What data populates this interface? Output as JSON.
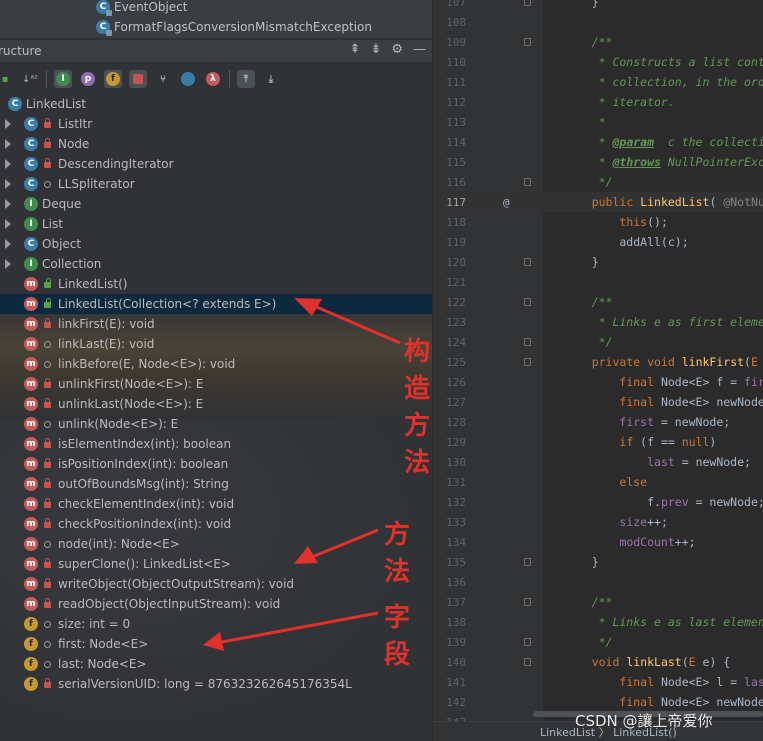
{
  "top_items": [
    {
      "label": "EventObject"
    },
    {
      "label": "FormatFlagsConversionMismatchException"
    }
  ],
  "panel": {
    "title": "ructure"
  },
  "toolbar": {
    "sort_label": "↓a",
    "sort_alpha": "z"
  },
  "tree": [
    {
      "label": "LinkedList",
      "icon": "c",
      "indent": 0,
      "arrow": false,
      "vis": ""
    },
    {
      "label": "ListItr",
      "icon": "c",
      "indent": 1,
      "arrow": true,
      "vis": "lock"
    },
    {
      "label": "Node",
      "icon": "c",
      "indent": 1,
      "arrow": true,
      "vis": "lock"
    },
    {
      "label": "DescendingIterator",
      "icon": "c",
      "indent": 1,
      "arrow": true,
      "vis": "lock"
    },
    {
      "label": "LLSpliterator",
      "icon": "c",
      "indent": 1,
      "arrow": true,
      "vis": "pkg"
    },
    {
      "label": "Deque",
      "icon": "i",
      "indent": 1,
      "arrow": true,
      "vis": "none"
    },
    {
      "label": "List",
      "icon": "i",
      "indent": 1,
      "arrow": true,
      "vis": "none"
    },
    {
      "label": "Object",
      "icon": "c",
      "indent": 1,
      "arrow": true,
      "vis": "none"
    },
    {
      "label": "Collection",
      "icon": "i",
      "indent": 1,
      "arrow": true,
      "vis": "none"
    },
    {
      "label": "LinkedList()",
      "icon": "m",
      "indent": 1,
      "arrow": false,
      "vis": "unlock"
    },
    {
      "label": "LinkedList(Collection<? extends E>)",
      "icon": "m",
      "indent": 1,
      "arrow": false,
      "vis": "unlock",
      "selected": true
    },
    {
      "label": "linkFirst(E): void",
      "icon": "m",
      "indent": 1,
      "arrow": false,
      "vis": "lock"
    },
    {
      "label": "linkLast(E): void",
      "icon": "m",
      "indent": 1,
      "arrow": false,
      "vis": "pkg"
    },
    {
      "label": "linkBefore(E, Node<E>): void",
      "icon": "m",
      "indent": 1,
      "arrow": false,
      "vis": "pkg"
    },
    {
      "label": "unlinkFirst(Node<E>): E",
      "icon": "m",
      "indent": 1,
      "arrow": false,
      "vis": "lock"
    },
    {
      "label": "unlinkLast(Node<E>): E",
      "icon": "m",
      "indent": 1,
      "arrow": false,
      "vis": "lock"
    },
    {
      "label": "unlink(Node<E>): E",
      "icon": "m",
      "indent": 1,
      "arrow": false,
      "vis": "pkg"
    },
    {
      "label": "isElementIndex(int): boolean",
      "icon": "m",
      "indent": 1,
      "arrow": false,
      "vis": "lock"
    },
    {
      "label": "isPositionIndex(int): boolean",
      "icon": "m",
      "indent": 1,
      "arrow": false,
      "vis": "lock"
    },
    {
      "label": "outOfBoundsMsg(int): String",
      "icon": "m",
      "indent": 1,
      "arrow": false,
      "vis": "lock"
    },
    {
      "label": "checkElementIndex(int): void",
      "icon": "m",
      "indent": 1,
      "arrow": false,
      "vis": "lock"
    },
    {
      "label": "checkPositionIndex(int): void",
      "icon": "m",
      "indent": 1,
      "arrow": false,
      "vis": "lock"
    },
    {
      "label": "node(int): Node<E>",
      "icon": "m",
      "indent": 1,
      "arrow": false,
      "vis": "pkg"
    },
    {
      "label": "superClone(): LinkedList<E>",
      "icon": "m",
      "indent": 1,
      "arrow": false,
      "vis": "lock"
    },
    {
      "label": "writeObject(ObjectOutputStream): void",
      "icon": "m",
      "indent": 1,
      "arrow": false,
      "vis": "lock"
    },
    {
      "label": "readObject(ObjectInputStream): void",
      "icon": "m",
      "indent": 1,
      "arrow": false,
      "vis": "lock"
    },
    {
      "label": "size: int = 0",
      "icon": "f",
      "indent": 1,
      "arrow": false,
      "vis": "pkg"
    },
    {
      "label": "first: Node<E>",
      "icon": "f",
      "indent": 1,
      "arrow": false,
      "vis": "pkg"
    },
    {
      "label": "last: Node<E>",
      "icon": "f",
      "indent": 1,
      "arrow": false,
      "vis": "pkg"
    },
    {
      "label": "serialVersionUID: long = 876323262645176354L",
      "icon": "f",
      "indent": 1,
      "arrow": false,
      "vis": "lock"
    }
  ],
  "annotations": {
    "constructor": "构造方法",
    "method": "方法",
    "field": "字段"
  },
  "editor": {
    "lines": [
      {
        "n": "107",
        "html": "    }"
      },
      {
        "n": "108",
        "html": ""
      },
      {
        "n": "109",
        "html": "    <span class='cm'>/**</span>"
      },
      {
        "n": "110",
        "html": "<span class='cm'>     * Constructs a list containi</span>"
      },
      {
        "n": "111",
        "html": "<span class='cm'>     * collection, in the order t</span>"
      },
      {
        "n": "112",
        "html": "<span class='cm'>     * iterator.</span>"
      },
      {
        "n": "113",
        "html": "<span class='cm'>     *</span>"
      },
      {
        "n": "114",
        "html": "<span class='cm'>     * </span><span class='tag'>@param</span><span class='cm'>  c the collection w</span>"
      },
      {
        "n": "115",
        "html": "<span class='cm'>     * </span><span class='tag'>@throws</span><span class='cm'> NullPointerExcepti</span>"
      },
      {
        "n": "116",
        "html": "<span class='cm'>     */</span>"
      },
      {
        "n": "117",
        "html": "    <span class='kw'>public</span> <span class='fn'>LinkedList</span>( <span class='gr'>@NotNull</span>()",
        "cur": true,
        "at": "@"
      },
      {
        "n": "118",
        "html": "        <span class='kw'>this</span>();"
      },
      {
        "n": "119",
        "html": "        addAll(c);"
      },
      {
        "n": "120",
        "html": "    }"
      },
      {
        "n": "121",
        "html": ""
      },
      {
        "n": "122",
        "html": "    <span class='cm'>/**</span>"
      },
      {
        "n": "123",
        "html": "<span class='cm'>     * Links e as first element.</span>"
      },
      {
        "n": "124",
        "html": "<span class='cm'>     */</span>"
      },
      {
        "n": "125",
        "html": "    <span class='kw'>private void</span> <span class='fn'>linkFirst</span>(<span class='kw'>E</span> e) {"
      },
      {
        "n": "126",
        "html": "        <span class='kw'>final</span> Node&lt;E&gt; f = <span class='fld'>first</span>;"
      },
      {
        "n": "127",
        "html": "        <span class='kw'>final</span> Node&lt;E&gt; newNode = <span class='kw'>n</span>"
      },
      {
        "n": "128",
        "html": "        <span class='fld'>first</span> = newNode;"
      },
      {
        "n": "129",
        "html": "        <span class='kw'>if</span> (f == <span class='kw'>null</span>)"
      },
      {
        "n": "130",
        "html": "            <span class='fld'>last</span> = newNode;"
      },
      {
        "n": "131",
        "html": "        <span class='kw'>else</span>"
      },
      {
        "n": "132",
        "html": "            f.<span class='fld'>prev</span> = newNode;"
      },
      {
        "n": "133",
        "html": "        <span class='fld'>size</span>++;"
      },
      {
        "n": "134",
        "html": "        <span class='fld'>modCount</span>++;"
      },
      {
        "n": "135",
        "html": "    }"
      },
      {
        "n": "136",
        "html": ""
      },
      {
        "n": "137",
        "html": "    <span class='cm'>/**</span>"
      },
      {
        "n": "138",
        "html": "<span class='cm'>     * Links e as last element.</span>"
      },
      {
        "n": "139",
        "html": "<span class='cm'>     */</span>"
      },
      {
        "n": "140",
        "html": "    <span class='kw'>void</span> <span class='fn'>linkLast</span>(<span class='kw'>E</span> e) {"
      },
      {
        "n": "141",
        "html": "        <span class='kw'>final</span> Node&lt;E&gt; l = <span class='fld'>last</span>;"
      },
      {
        "n": "142",
        "html": "        <span class='kw'>final</span> Node&lt;E&gt; newNode = <span class='kw'>n</span>"
      },
      {
        "n": "143",
        "html": ""
      }
    ],
    "breadcrumb": "LinkedList 〉 LinkedList()"
  },
  "watermark": "CSDN @讓上帝爱你",
  "colors": {
    "annotation": "#e0312c",
    "selection": "#0d293e"
  }
}
